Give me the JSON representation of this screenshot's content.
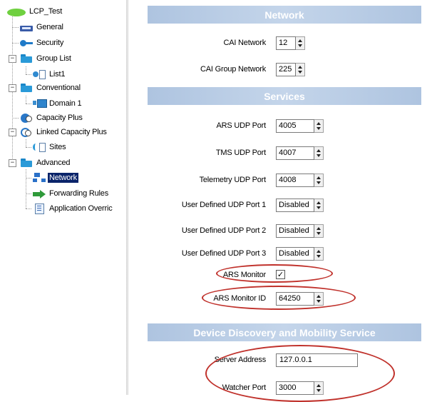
{
  "tree": {
    "root": "LCP_Test",
    "general": "General",
    "security": "Security",
    "group_list": "Group List",
    "list1": "List1",
    "conventional": "Conventional",
    "domain1": "Domain 1",
    "capacity_plus": "Capacity Plus",
    "linked_capacity_plus": "Linked Capacity Plus",
    "sites": "Sites",
    "advanced": "Advanced",
    "network": "Network",
    "forwarding_rules": "Forwarding Rules",
    "application_override": "Application Overric",
    "expander_minus": "−"
  },
  "sections": {
    "network": "Network",
    "services": "Services",
    "device_discovery": "Device Discovery and Mobility Service"
  },
  "fields": {
    "cai_network": {
      "label": "CAI Network",
      "value": "12"
    },
    "cai_group_network": {
      "label": "CAI Group Network",
      "value": "225"
    },
    "ars_udp_port": {
      "label": "ARS UDP Port",
      "value": "4005"
    },
    "tms_udp_port": {
      "label": "TMS UDP Port",
      "value": "4007"
    },
    "telemetry_udp_port": {
      "label": "Telemetry UDP Port",
      "value": "4008"
    },
    "user_udp_port_1": {
      "label": "User Defined UDP Port 1",
      "value": "Disabled"
    },
    "user_udp_port_2": {
      "label": "User Defined UDP Port 2",
      "value": "Disabled"
    },
    "user_udp_port_3": {
      "label": "User Defined UDP Port 3",
      "value": "Disabled"
    },
    "ars_monitor": {
      "label": "ARS Monitor",
      "checked": true,
      "mark": "✓"
    },
    "ars_monitor_id": {
      "label": "ARS Monitor ID",
      "value": "64250"
    },
    "server_address": {
      "label": "Server Address",
      "value": "127.0.0.1"
    },
    "watcher_port": {
      "label": "Watcher Port",
      "value": "3000"
    }
  },
  "colors": {
    "section_band": "#b4c8e4",
    "annotation": "#c0312b",
    "selection": "#0a246a"
  }
}
